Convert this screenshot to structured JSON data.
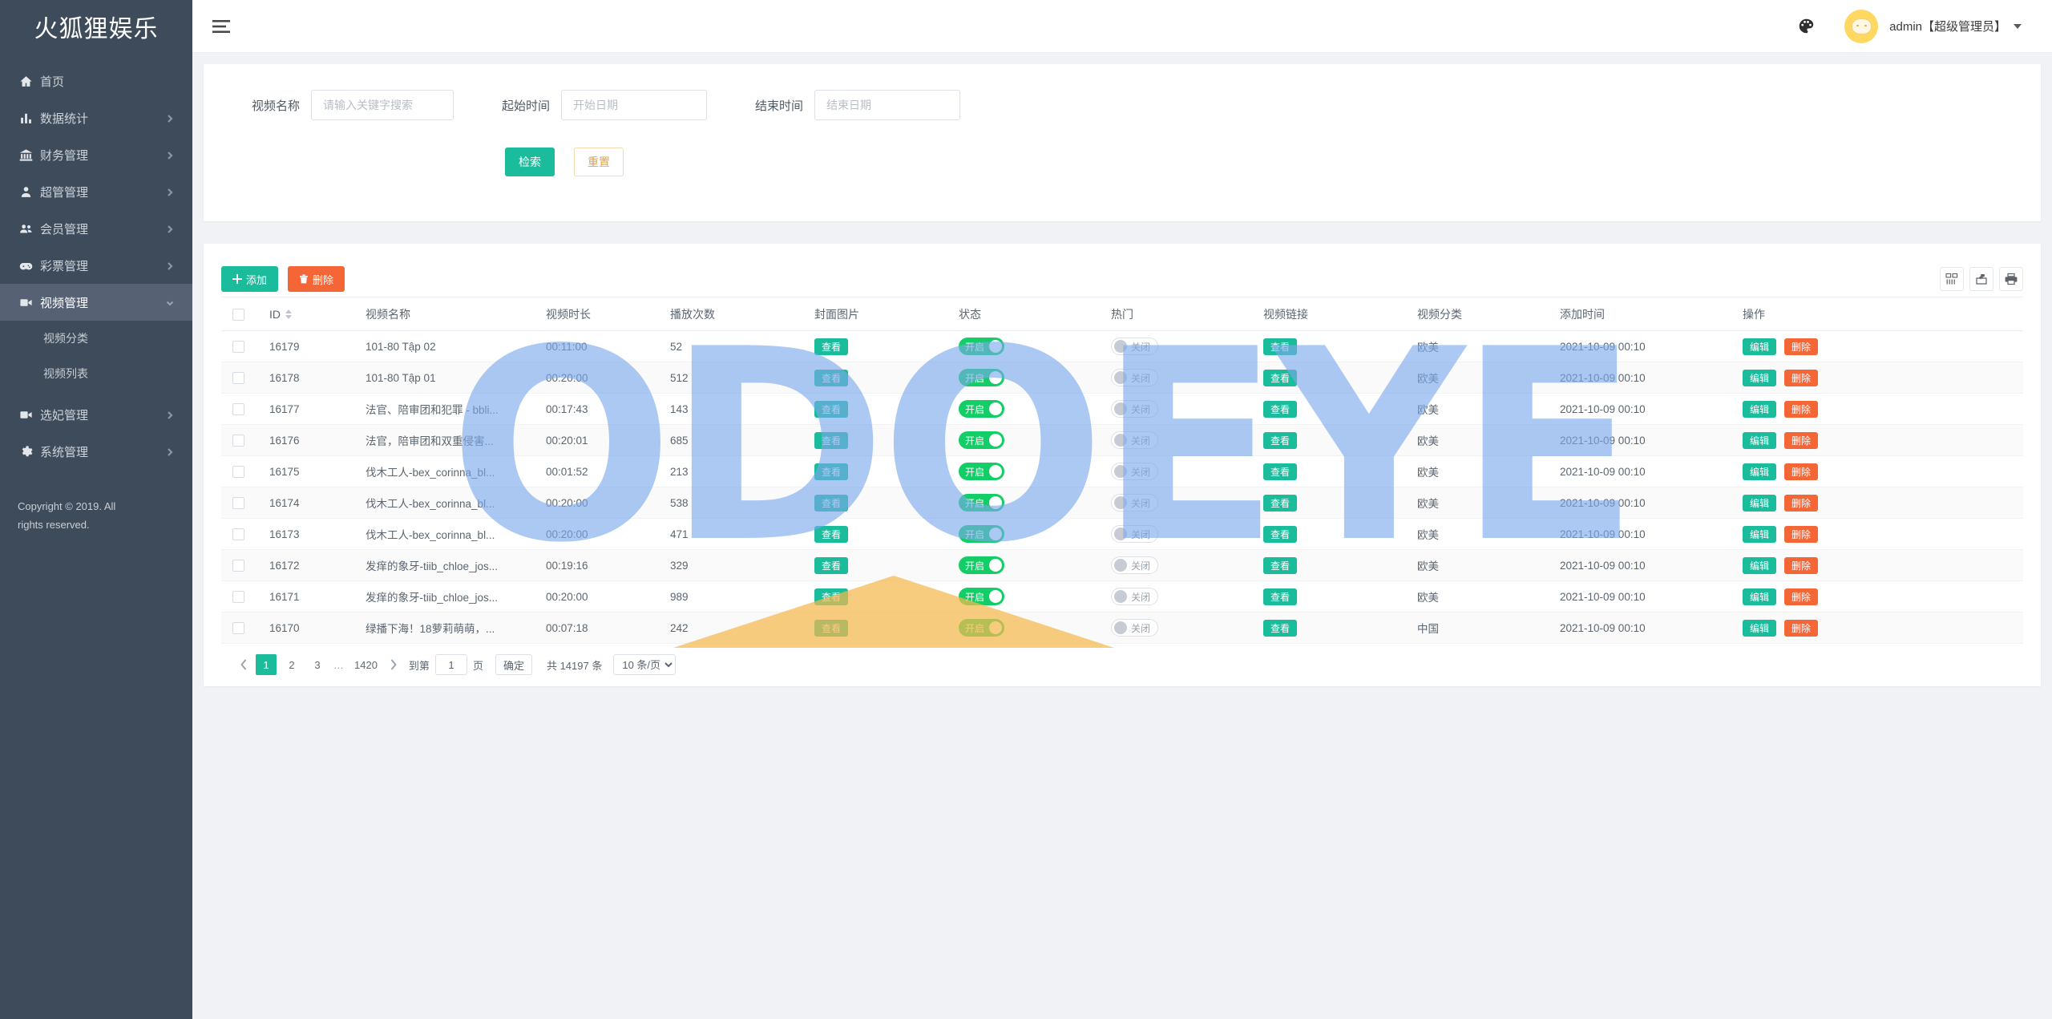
{
  "brand": {
    "title": "火狐狸娱乐"
  },
  "topbar": {
    "hamburger_icon": "menu-icon",
    "theme_icon": "palette-icon",
    "username": "admin【超级管理员】"
  },
  "sidebar": {
    "items": [
      {
        "label": "首页",
        "icon": "home-icon",
        "arrow": false,
        "active": false
      },
      {
        "label": "数据统计",
        "icon": "chart-icon",
        "arrow": true,
        "active": false
      },
      {
        "label": "财务管理",
        "icon": "bank-icon",
        "arrow": true,
        "active": false
      },
      {
        "label": "超管管理",
        "icon": "user-icon",
        "arrow": true,
        "active": false
      },
      {
        "label": "会员管理",
        "icon": "users-icon",
        "arrow": true,
        "active": false
      },
      {
        "label": "彩票管理",
        "icon": "gamepad-icon",
        "arrow": true,
        "active": false
      },
      {
        "label": "视频管理",
        "icon": "video-icon",
        "arrow": true,
        "active": true
      }
    ],
    "submenu": [
      {
        "label": "视频分类"
      },
      {
        "label": "视频列表"
      }
    ],
    "items_after": [
      {
        "label": "选妃管理",
        "icon": "video-icon",
        "arrow": true
      },
      {
        "label": "系统管理",
        "icon": "gear-icon",
        "arrow": true
      }
    ],
    "copyright": "Copyright © 2019. All rights reserved."
  },
  "filter": {
    "name_label": "视频名称",
    "name_placeholder": "请输入关键字搜索",
    "name_value": "",
    "start_label": "起始时间",
    "start_placeholder": "开始日期",
    "start_value": "",
    "end_label": "结束时间",
    "end_placeholder": "结束日期",
    "end_value": "",
    "search_btn": "检索",
    "reset_btn": "重置"
  },
  "toolbar": {
    "add_label": "添加",
    "delete_label": "删除",
    "icons": [
      "columns-icon",
      "export-icon",
      "print-icon"
    ]
  },
  "table": {
    "columns": [
      "ID",
      "视频名称",
      "视频时长",
      "播放次数",
      "封面图片",
      "状态",
      "热门",
      "视频链接",
      "视频分类",
      "添加时间",
      "操作"
    ],
    "view_label": "查看",
    "on_label": "开启",
    "off_label": "关闭",
    "edit_label": "编辑",
    "delete_label": "删除",
    "rows": [
      {
        "id": "16179",
        "name": "101-80 Tập 02",
        "duration": "00:11:00",
        "plays": "52",
        "cover": "查看",
        "status": "开启",
        "hot": "关闭",
        "link": "查看",
        "category": "欧美",
        "time": "2021-10-09 00:10"
      },
      {
        "id": "16178",
        "name": "101-80 Tập 01",
        "duration": "00:20:00",
        "plays": "512",
        "cover": "查看",
        "status": "开启",
        "hot": "关闭",
        "link": "查看",
        "category": "欧美",
        "time": "2021-10-09 00:10"
      },
      {
        "id": "16177",
        "name": "法官、陪审团和犯罪 - bbli...",
        "duration": "00:17:43",
        "plays": "143",
        "cover": "查看",
        "status": "开启",
        "hot": "关闭",
        "link": "查看",
        "category": "欧美",
        "time": "2021-10-09 00:10"
      },
      {
        "id": "16176",
        "name": "法官，陪审团和双重侵害...",
        "duration": "00:20:01",
        "plays": "685",
        "cover": "查看",
        "status": "开启",
        "hot": "关闭",
        "link": "查看",
        "category": "欧美",
        "time": "2021-10-09 00:10"
      },
      {
        "id": "16175",
        "name": "伐木工人-bex_corinna_bl...",
        "duration": "00:01:52",
        "plays": "213",
        "cover": "查看",
        "status": "开启",
        "hot": "关闭",
        "link": "查看",
        "category": "欧美",
        "time": "2021-10-09 00:10"
      },
      {
        "id": "16174",
        "name": "伐木工人-bex_corinna_bl...",
        "duration": "00:20:00",
        "plays": "538",
        "cover": "查看",
        "status": "开启",
        "hot": "关闭",
        "link": "查看",
        "category": "欧美",
        "time": "2021-10-09 00:10"
      },
      {
        "id": "16173",
        "name": "伐木工人-bex_corinna_bl...",
        "duration": "00:20:00",
        "plays": "471",
        "cover": "查看",
        "status": "开启",
        "hot": "关闭",
        "link": "查看",
        "category": "欧美",
        "time": "2021-10-09 00:10"
      },
      {
        "id": "16172",
        "name": "发痒的象牙-tiib_chloe_jos...",
        "duration": "00:19:16",
        "plays": "329",
        "cover": "查看",
        "status": "开启",
        "hot": "关闭",
        "link": "查看",
        "category": "欧美",
        "time": "2021-10-09 00:10"
      },
      {
        "id": "16171",
        "name": "发痒的象牙-tiib_chloe_jos...",
        "duration": "00:20:00",
        "plays": "989",
        "cover": "查看",
        "status": "开启",
        "hot": "关闭",
        "link": "查看",
        "category": "欧美",
        "time": "2021-10-09 00:10"
      },
      {
        "id": "16170",
        "name": "绿播下海！18萝莉萌萌，...",
        "duration": "00:07:18",
        "plays": "242",
        "cover": "查看",
        "status": "开启",
        "hot": "关闭",
        "link": "查看",
        "category": "中国",
        "time": "2021-10-09 00:10"
      }
    ]
  },
  "pagination": {
    "pages": [
      "1",
      "2",
      "3"
    ],
    "ellipsis": "…",
    "last_page": "1420",
    "current": "1",
    "jump_prefix": "到第",
    "jump_value": "1",
    "jump_suffix": "页",
    "confirm": "确定",
    "total": "共 14197 条",
    "page_size": "10 条/页"
  },
  "watermark": {
    "text": "ODOEYE",
    "color": "#7aa9ec",
    "accent_color": "#f5b94e"
  }
}
